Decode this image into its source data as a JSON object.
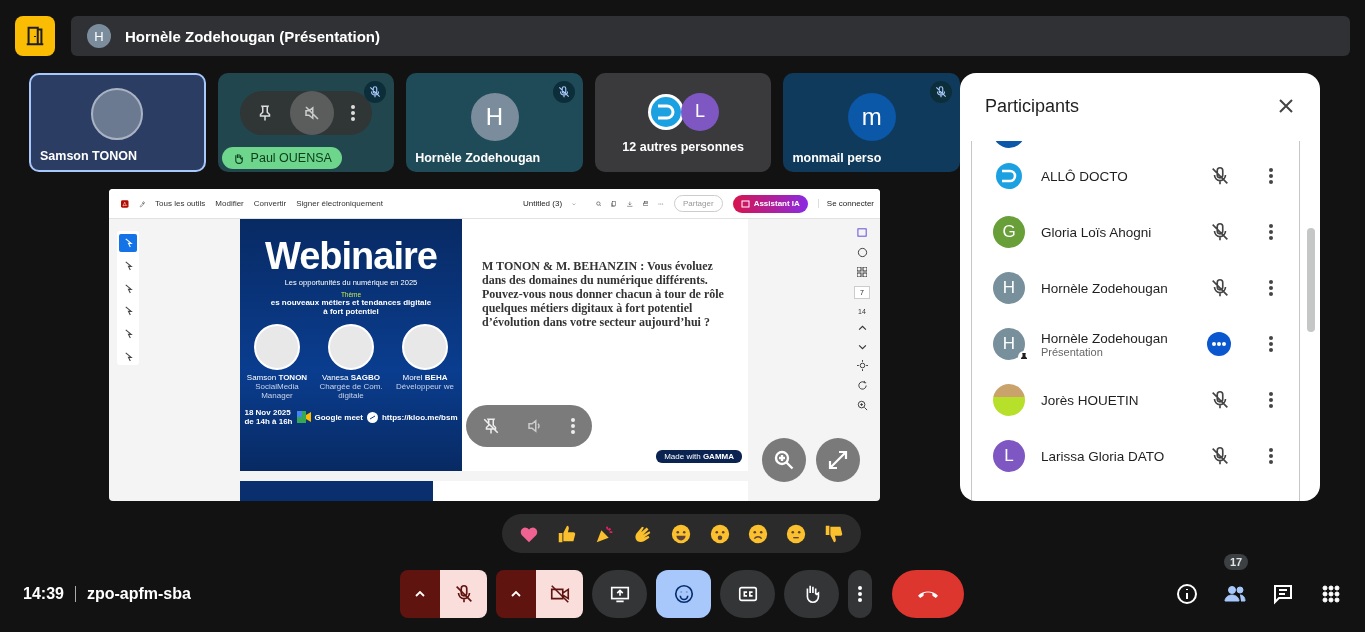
{
  "header": {
    "avatar": "H",
    "title": "Hornèle Zodehougan (Présentation)"
  },
  "tiles": [
    {
      "kind": "photo",
      "name": "Samson TONON",
      "selected": true,
      "muted": false,
      "hand_raised": false
    },
    {
      "kind": "hover",
      "name": "Paul OUENSA",
      "selected": false,
      "muted": true,
      "hand_raised": true
    },
    {
      "kind": "initial",
      "name": "Hornèle Zodehougan",
      "initial": "H",
      "color": "#7b8d9c",
      "selected": false,
      "muted": true,
      "hand_raised": false
    },
    {
      "kind": "group",
      "name": "12 autres personnes",
      "initial": "L",
      "color": "#7e57c2",
      "selected": false,
      "muted": false,
      "hand_raised": false
    },
    {
      "kind": "initial",
      "name": "monmail perso",
      "initial": "m",
      "color": "#0b57a8",
      "selected": false,
      "muted": true,
      "hand_raised": false
    }
  ],
  "presentation": {
    "menu": [
      "Tous les outils",
      "Modifier",
      "Convertir",
      "Signer électroniquement"
    ],
    "doc_title": "Untitled (3)",
    "share": "Partager",
    "assistant": "Assistant IA",
    "login": "Se connecter",
    "tools": [
      {
        "selected": true
      },
      {
        "selected": false
      },
      {
        "selected": false
      },
      {
        "selected": false
      },
      {
        "selected": false
      },
      {
        "selected": false
      }
    ],
    "slide": {
      "title": "Webinaire",
      "subtitle": "Les opportunités du numérique en 2025",
      "theme_label": "Thème",
      "theme": "es nouveaux métiers et tendances digitale",
      "theme_2": "à fort potentiel",
      "speakers": [
        {
          "name": "Samson **TONON**",
          "role": "SocialMedia Manager"
        },
        {
          "name": "Vanesa **SAGBO**",
          "role": "Chargée de Com. digitale"
        },
        {
          "name": "Morel **BEHA**",
          "role": "Développeur we"
        }
      ],
      "date": "18 Nov 2025",
      "time": "de 14h à 16h",
      "meet": "Google meet",
      "link": "https://kloo.me/bsm",
      "question": "M TONON & M. BEHANZIN : Vous évoluez dans des domaines du numérique différents. Pouvez-vous nous donner chacun à tour de rôle quelques métiers digitaux à fort potentiel d’évolution dans votre secteur aujourd’hui ?",
      "badge": "Made with **GAMMA**"
    },
    "pages": [
      "7",
      "14"
    ]
  },
  "participants": {
    "title": "Participants",
    "rows": [
      {
        "kind": "logo",
        "name": "ALLÔ DOCTO",
        "muted": true,
        "pinned": false
      },
      {
        "kind": "initial",
        "initial": "G",
        "color": "#689f38",
        "name": "Gloria Loïs Ahogni",
        "muted": true,
        "pinned": false
      },
      {
        "kind": "initial",
        "initial": "H",
        "color": "#78909c",
        "name": "Hornèle Zodehougan",
        "muted": true,
        "pinned": false
      },
      {
        "kind": "initial",
        "initial": "H",
        "color": "#78909c",
        "name": "Hornèle Zodehougan",
        "subtitle": "Présentation",
        "muted": false,
        "pinned": true
      },
      {
        "kind": "photo",
        "name": "Jorès HOUETIN",
        "muted": true,
        "pinned": false
      },
      {
        "kind": "initial",
        "initial": "L",
        "color": "#7e57c2",
        "name": "Larissa Gloria DATO",
        "muted": true,
        "pinned": false
      }
    ]
  },
  "footer": {
    "time": "14:39",
    "code": "zpo-apfm-sba",
    "controls": [
      {
        "kind": "mic",
        "on": false
      },
      {
        "kind": "camera",
        "on": false
      },
      {
        "kind": "present",
        "selected": false
      },
      {
        "kind": "reactions",
        "selected": true
      },
      {
        "kind": "captions",
        "selected": false
      },
      {
        "kind": "hand",
        "selected": false
      },
      {
        "kind": "more"
      },
      {
        "kind": "leave"
      }
    ],
    "side": [
      {
        "kind": "info",
        "selected": false
      },
      {
        "kind": "people",
        "selected": true,
        "badge": "17"
      },
      {
        "kind": "chat",
        "selected": false
      },
      {
        "kind": "activities",
        "selected": false
      }
    ]
  }
}
